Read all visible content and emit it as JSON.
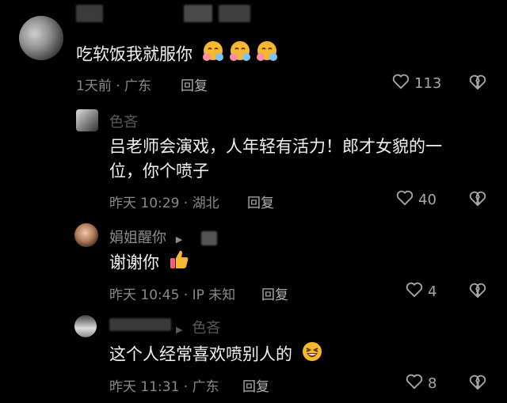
{
  "comments": [
    {
      "text": "吃软饭我就服你",
      "time": "1天前",
      "location": "广东",
      "reply_label": "回复",
      "likes": "113",
      "emojis": [
        "hugging-face-icon",
        "hugging-face-icon",
        "hugging-face-icon"
      ]
    },
    {
      "author": "色吝",
      "text_line1": "吕老师会演戏，人年轻有活力！郎才女貌的一",
      "text_line2": "位，你个喷子",
      "time": "昨天 10:29",
      "location": "湖北",
      "reply_label": "回复",
      "likes": "40"
    },
    {
      "author": "娟姐醒你",
      "text": "谢谢你",
      "time": "昨天 10:45",
      "location": "IP 未知",
      "reply_label": "回复",
      "likes": "4",
      "emoji": "thumbs-up-icon"
    },
    {
      "author_reply_to": "色吝",
      "text": "这个人经常喜欢喷别人的",
      "time": "昨天 11:31",
      "location": "广东",
      "reply_label": "回复",
      "likes": "8",
      "emoji": "laughing-face-icon"
    }
  ],
  "separator": "·",
  "colors": {
    "background": "#000000",
    "text": "#f2f2f2",
    "meta": "#8a8a8a",
    "accent_emoji": "#f5b82e"
  }
}
